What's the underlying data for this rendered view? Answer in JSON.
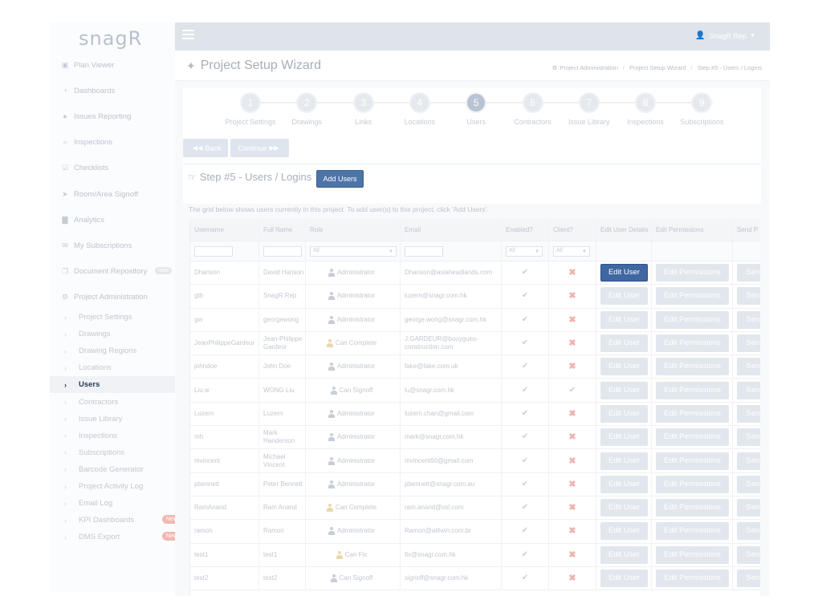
{
  "app": {
    "logo": "snagR"
  },
  "topbar": {
    "user_name": "SnagR Rep"
  },
  "sidebar": {
    "items": [
      {
        "label": "Plan Viewer",
        "icon": "image-icon"
      },
      {
        "label": "Dashboards",
        "icon": "dashboard-icon"
      },
      {
        "label": "Issues Reporting",
        "icon": "pin-icon"
      },
      {
        "label": "Inspections",
        "icon": "search-icon"
      },
      {
        "label": "Checklists",
        "icon": "checkbox-icon"
      },
      {
        "label": "Room/Area Signoff",
        "icon": "send-icon"
      },
      {
        "label": "Analytics",
        "icon": "bar-chart-icon"
      },
      {
        "label": "My Subscriptions",
        "icon": "envelope-icon"
      },
      {
        "label": "Document Repository",
        "icon": "copy-icon",
        "badge": "new"
      },
      {
        "label": "Project Administration",
        "icon": "gears-icon"
      }
    ],
    "sub_items": [
      {
        "label": "Project Settings"
      },
      {
        "label": "Drawings"
      },
      {
        "label": "Drawing Regions"
      },
      {
        "label": "Locations"
      },
      {
        "label": "Users",
        "active": true
      },
      {
        "label": "Contractors"
      },
      {
        "label": "Issue Library"
      },
      {
        "label": "Inspections"
      },
      {
        "label": "Subscriptions"
      },
      {
        "label": "Barcode Generator"
      },
      {
        "label": "Project Activity Log"
      },
      {
        "label": "Email Log"
      },
      {
        "label": "KPI Dashboards",
        "badge": "New"
      },
      {
        "label": "DMS Export",
        "badge": "New"
      }
    ]
  },
  "header": {
    "title": "Project Setup Wizard",
    "breadcrumb": [
      "Project Administration",
      "Project Setup Wizard",
      "Step #5 - Users / Logins"
    ]
  },
  "wizard": {
    "steps": [
      {
        "num": "1",
        "label": "Project Settings"
      },
      {
        "num": "2",
        "label": "Drawings"
      },
      {
        "num": "3",
        "label": "Links"
      },
      {
        "num": "4",
        "label": "Locations"
      },
      {
        "num": "5",
        "label": "Users",
        "active": true
      },
      {
        "num": "6",
        "label": "Contractors"
      },
      {
        "num": "7",
        "label": "Issue Library"
      },
      {
        "num": "8",
        "label": "Inspections"
      },
      {
        "num": "9",
        "label": "Subscriptions"
      }
    ],
    "back_label": "Back",
    "continue_label": "Continue",
    "step_heading": "Step #5 - Users / Logins",
    "add_users_label": "Add Users",
    "info": "The grid below shows users currently in this project. To add user(s) to this project, click 'Add Users'."
  },
  "grid": {
    "columns": [
      "Username",
      "Full Name",
      "Role",
      "Email",
      "Enabled?",
      "Client?",
      "Edit User Details",
      "Edit Permissions",
      "Send P"
    ],
    "filter_all": "All",
    "edit_user_label": "Edit User",
    "edit_permissions_label": "Edit Permissions",
    "send_label": "Sen",
    "rows": [
      {
        "username": "Dhanson",
        "fullname": "David Hanson",
        "role": "Administrator",
        "role_icon": "gray",
        "email": "Dhanson@asiaheadlands.com",
        "enabled": true,
        "client": false,
        "highlight": true
      },
      {
        "username": "gth",
        "fullname": "SnagR Rep",
        "role": "Administrator",
        "role_icon": "gray",
        "email": "luzern@snagr.com.hk",
        "enabled": true,
        "client": false
      },
      {
        "username": "gw",
        "fullname": "georgewong",
        "role": "Administrator",
        "role_icon": "gray",
        "email": "george.wong@snagr.com.hk",
        "enabled": true,
        "client": false
      },
      {
        "username": "JeanPhilippeGardeur",
        "fullname": "Jean-Philippe Gardeur",
        "role": "Can Complete",
        "role_icon": "gold",
        "email": "J.GARDEUR@bouygues-construction.com",
        "enabled": true,
        "client": false
      },
      {
        "username": "johndoe",
        "fullname": "John Doe",
        "role": "Administrator",
        "role_icon": "gray",
        "email": "fake@fake.com.uk",
        "enabled": true,
        "client": false
      },
      {
        "username": "Liu.w",
        "fullname": "WONG Liu",
        "role": "Can Signoff",
        "role_icon": "gray",
        "email": "lu@snagr.com.hk",
        "enabled": true,
        "client": true
      },
      {
        "username": "Luzern",
        "fullname": "Luzern",
        "role": "Administrator",
        "role_icon": "gray",
        "email": "luzern.chan@gmail.com",
        "enabled": true,
        "client": false
      },
      {
        "username": "mh",
        "fullname": "Mark Handerson",
        "role": "Administrator",
        "role_icon": "gray",
        "email": "mark@snagr.com.hk",
        "enabled": true,
        "client": false
      },
      {
        "username": "mvincent",
        "fullname": "Michael Vincent",
        "role": "Administrator",
        "role_icon": "gray",
        "email": "mvincent60@gmail.com",
        "enabled": true,
        "client": false
      },
      {
        "username": "pbennett",
        "fullname": "Peter Bennett",
        "role": "Administrator",
        "role_icon": "gray",
        "email": "pbennett@snagr.com.au",
        "enabled": true,
        "client": false
      },
      {
        "username": "RamAnand",
        "fullname": "Ram Anand",
        "role": "Can Complete",
        "role_icon": "gold",
        "email": "ram.anand@vsl.com",
        "enabled": true,
        "client": false
      },
      {
        "username": "ramon",
        "fullname": "Ramon",
        "role": "Administrator",
        "role_icon": "gray",
        "email": "Ramon@alitwin.com.br",
        "enabled": true,
        "client": false
      },
      {
        "username": "test1",
        "fullname": "test1",
        "role": "Can Fix",
        "role_icon": "gold",
        "email": "fix@snagr.com.hk",
        "enabled": true,
        "client": false
      },
      {
        "username": "test2",
        "fullname": "test2",
        "role": "Can Signoff",
        "role_icon": "gray",
        "email": "signoff@snagr.com.hk",
        "enabled": true,
        "client": false
      }
    ]
  },
  "colors": {
    "primary": "#3f67a1",
    "topbar": "#dfe3ea",
    "active_text": "#2d3b57",
    "cross": "#f0b3ad"
  }
}
